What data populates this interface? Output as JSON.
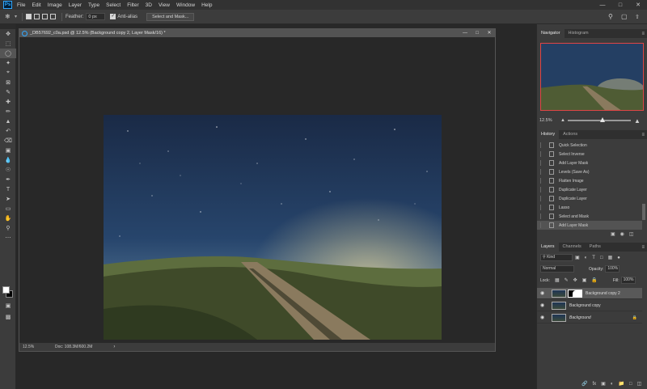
{
  "app": {
    "logo": "Ps"
  },
  "menu": [
    "File",
    "Edit",
    "Image",
    "Layer",
    "Type",
    "Select",
    "Filter",
    "3D",
    "View",
    "Window",
    "Help"
  ],
  "options": {
    "feather_label": "Feather:",
    "feather_value": "0 px",
    "antialias_label": "Anti-alias",
    "select_mask_label": "Select and Mask..."
  },
  "document": {
    "tab_title": "_DB57692_c0a.psd @ 12.5% (Background copy 2, Layer Mask/16) *",
    "zoom": "12.5%",
    "doc_size": "Doc: 108.3M/600.2M"
  },
  "navigator": {
    "tabs": [
      "Navigator",
      "Histogram"
    ],
    "zoom": "12.5%",
    "zoom_level": 0.55
  },
  "history": {
    "tabs": [
      "History",
      "Actions"
    ],
    "items": [
      "Quick Selection",
      "Select Inverse",
      "Add Layer Mask",
      "Levels (Save As)",
      "Flatten Image",
      "Duplicate Layer",
      "Duplicate Layer",
      "Lasso",
      "Select and Mask",
      "Add Layer Mask"
    ]
  },
  "layers_panel": {
    "tabs": [
      "Layers",
      "Channels",
      "Paths"
    ],
    "kind": "Kind",
    "blend_mode": "Normal",
    "opacity_label": "Opacity:",
    "opacity": "100%",
    "lock_label": "Lock:",
    "fill_label": "Fill:",
    "fill": "100%",
    "layers": [
      {
        "name": "Background copy 2"
      },
      {
        "name": "Background copy"
      },
      {
        "name": "Background"
      }
    ]
  },
  "colors": {
    "accent": "#31a8ff",
    "nav_frame": "#e04545"
  }
}
